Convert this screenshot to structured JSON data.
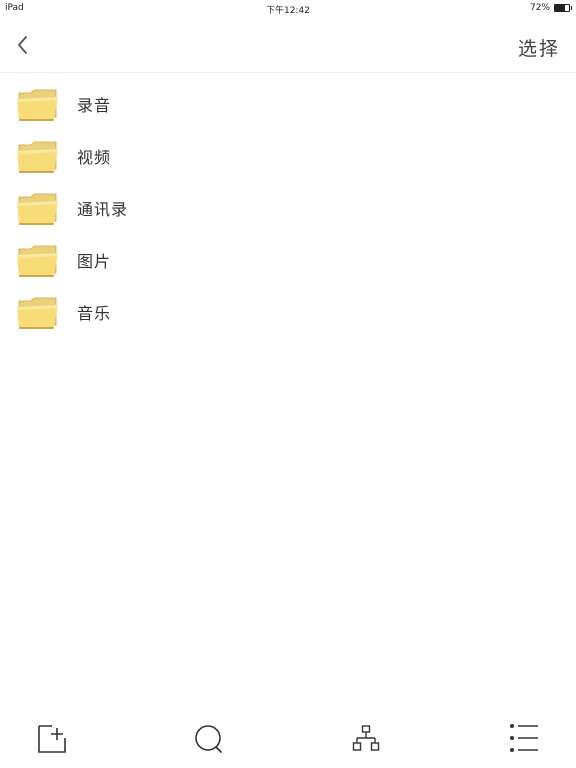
{
  "status_bar": {
    "device": "iPad",
    "time": "下午12:42",
    "battery": "72%",
    "battery_level": 0.72
  },
  "nav": {
    "back_icon": "chevron-left-icon",
    "select_label": "选择"
  },
  "folders": [
    {
      "label": "录音",
      "icon": "folder-icon"
    },
    {
      "label": "视频",
      "icon": "folder-icon"
    },
    {
      "label": "通讯录",
      "icon": "folder-icon"
    },
    {
      "label": "图片",
      "icon": "folder-icon"
    },
    {
      "label": "音乐",
      "icon": "folder-icon"
    }
  ],
  "toolbar": {
    "items": [
      "new-folder-icon",
      "search-icon",
      "hierarchy-icon",
      "list-icon"
    ]
  },
  "colors": {
    "folder_yellow": "#f6d874",
    "folder_back": "#ead078",
    "icon_stroke": "#333333"
  }
}
